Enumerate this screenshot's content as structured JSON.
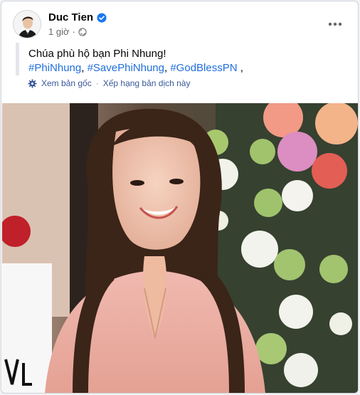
{
  "post": {
    "author": "Duc Tien",
    "time": "1 giờ",
    "text_line1": "Chúa phù hộ bạn Phi Nhung!",
    "hashtags": [
      "#PhiNhung",
      "#SavePhiNhung",
      "#GodBlessPN"
    ],
    "sep1": ", ",
    "sep2": ", ",
    "trailing": " ,",
    "translate_original": "Xem bản gốc",
    "translate_dot": "·",
    "translate_rate": "Xếp hạng bản dịch này"
  },
  "icons": {
    "verified": "verified-badge-icon",
    "privacy": "globe-icon",
    "more": "more-horizontal-icon",
    "translate": "gear-icon"
  },
  "colors": {
    "link": "#216fdb",
    "verified": "#1877f2",
    "muted": "#65676b"
  }
}
